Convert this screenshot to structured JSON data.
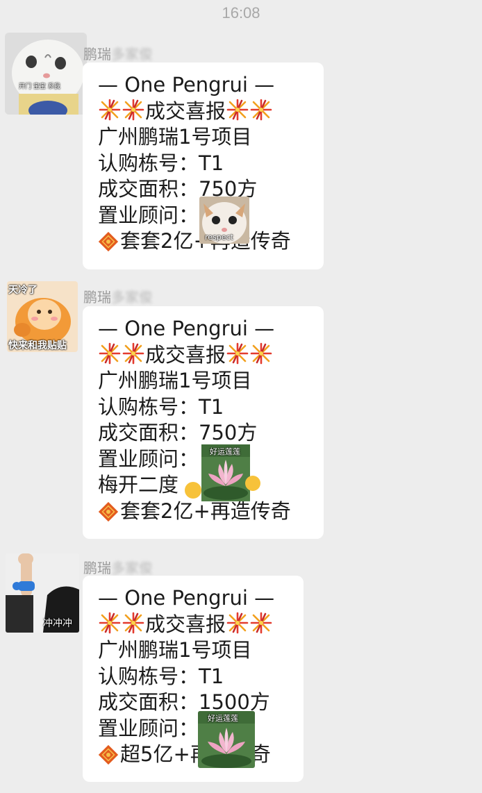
{
  "status_time": "16:08",
  "messages": [
    {
      "sender": "鹏瑞",
      "sender_blur": "多家俊",
      "avatar_caption": "开门 宝宝 系我",
      "sticker_caption": "respect",
      "lines": {
        "brand": "— One Pengrui —",
        "headline": "成交喜报",
        "project": "广州鹏瑞1号项目",
        "building": "认购栋号：T1",
        "area": "成交面积：750方",
        "consultant": "置业顾问：",
        "closing": "套套2亿+再造传奇"
      }
    },
    {
      "sender": "鹏瑞",
      "sender_blur": "多家俊",
      "avatar_caption_top": "天冷了",
      "avatar_caption_bottom": "快来和我贴贴",
      "sticker_caption": "好运莲莲",
      "lines": {
        "brand": "— One Pengrui —",
        "headline": "成交喜报",
        "project": "广州鹏瑞1号项目",
        "building": "认购栋号：T1",
        "area": "成交面积：750方",
        "consultant": "置业顾问：",
        "extra": "梅开二度",
        "closing": "套套2亿+再造传奇"
      }
    },
    {
      "sender": "鹏瑞",
      "sender_blur": "多家俊",
      "avatar_caption": "冲冲冲",
      "sticker_caption": "好运莲莲",
      "lines": {
        "brand": "— One Pengrui —",
        "headline": "成交喜报",
        "project": "广州鹏瑞1号项目",
        "building": "认购栋号：T1",
        "area": "成交面积：1500方",
        "consultant": "置业顾问：",
        "closing": "超5亿+再造传奇"
      }
    }
  ],
  "colors": {
    "background": "#ededed",
    "bubble": "#ffffff",
    "text": "#1b1b1b",
    "firework": "#e0443a",
    "ingot": "#e35b1e"
  }
}
